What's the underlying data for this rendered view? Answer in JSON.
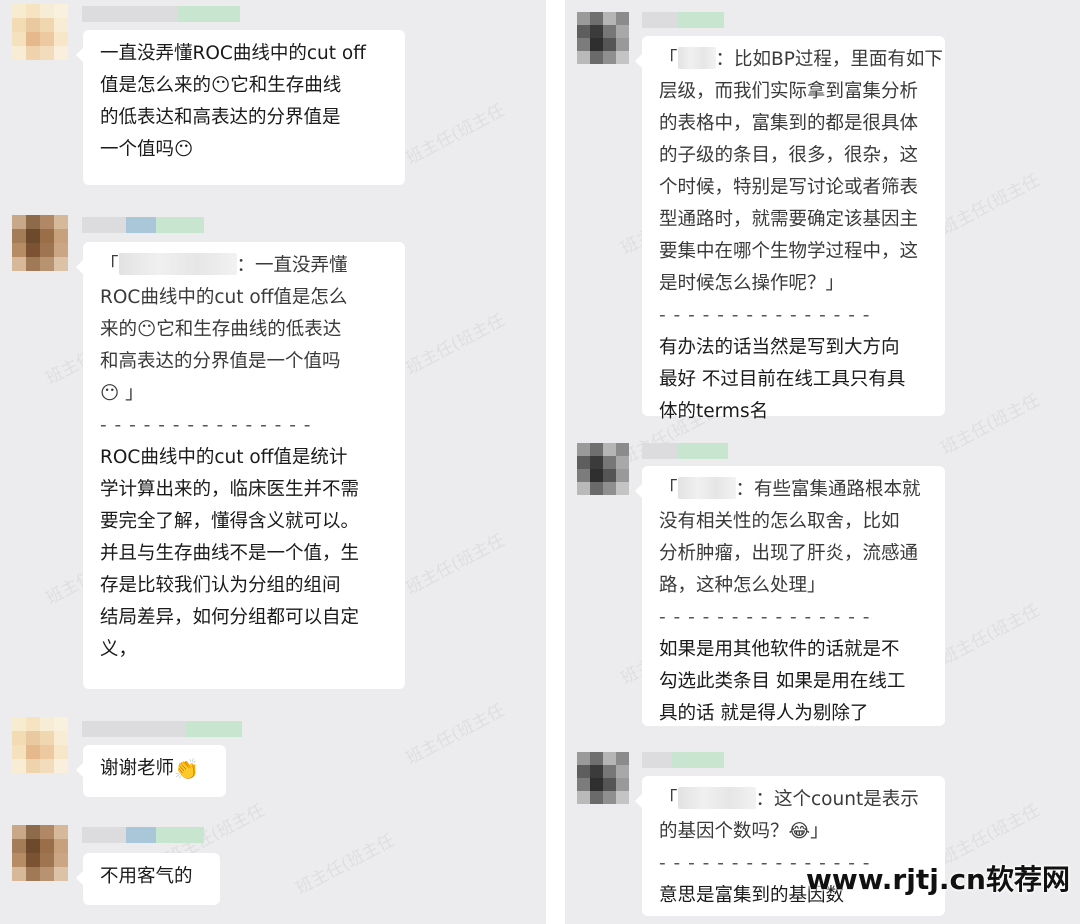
{
  "watermark_text": "班主任(班主任",
  "site_watermark": "www.rjtj.cn软荐网",
  "left_messages": [
    {
      "lines": [
        "一直没弄懂ROC曲线中的cut off",
        "值是怎么来的😶它和生存曲线",
        "的低表达和高表达的分界值是",
        "一个值吗😶"
      ]
    },
    {
      "quote_tail": "：一直没弄懂",
      "quote_lines": [
        "ROC曲线中的cut off值是怎么",
        "来的😶它和生存曲线的低表达",
        "和高表达的分界值是一个值吗",
        "😶 」"
      ],
      "separator": "- - - - - - - - - - - - - - -",
      "reply_lines": [
        "ROC曲线中的cut off值是统计",
        "学计算出来的，临床医生并不需",
        "要完全了解，懂得含义就可以。",
        "并且与生存曲线不是一个值，生",
        "存是比较我们认为分组的组间",
        "结局差异，如何分组都可以自定",
        "义，"
      ]
    },
    {
      "text": "谢谢老师"
    },
    {
      "text": "不用客气的"
    }
  ],
  "right_messages": [
    {
      "quote_tail": "：比如BP过程，里面有如下",
      "quote_lines": [
        "层级，而我们实际拿到富集分析",
        "的表格中，富集到的都是很具体",
        "的子级的条目，很多，很杂，这",
        "个时候，特别是写讨论或者筛表",
        "型通路时，就需要确定该基因主",
        "要集中在哪个生物学过程中，这",
        "是时候怎么操作呢？」"
      ],
      "separator": "- - - - - - - - - - - - - - -",
      "reply_lines": [
        "有办法的话当然是写到大方向",
        "最好 不过目前在线工具只有具",
        "体的terms名"
      ]
    },
    {
      "quote_tail": "：有些富集通路根本就",
      "quote_lines": [
        "没有相关性的怎么取舍，比如",
        "分析肿瘤，出现了肝炎，流感通",
        "路，这种怎么处理」"
      ],
      "separator": "- - - - - - - - - - - - - - -",
      "reply_lines": [
        "如果是用其他软件的话就是不",
        "勾选此类条目 如果是用在线工",
        "具的话 就是得人为剔除了"
      ]
    },
    {
      "quote_tail": "：这个count是表示",
      "quote_lines": [
        "的基因个数吗？😂」"
      ],
      "separator": "- - - - - - - - - - - - - - -",
      "reply_lines": [
        "意思是富集到的基因数"
      ]
    }
  ]
}
